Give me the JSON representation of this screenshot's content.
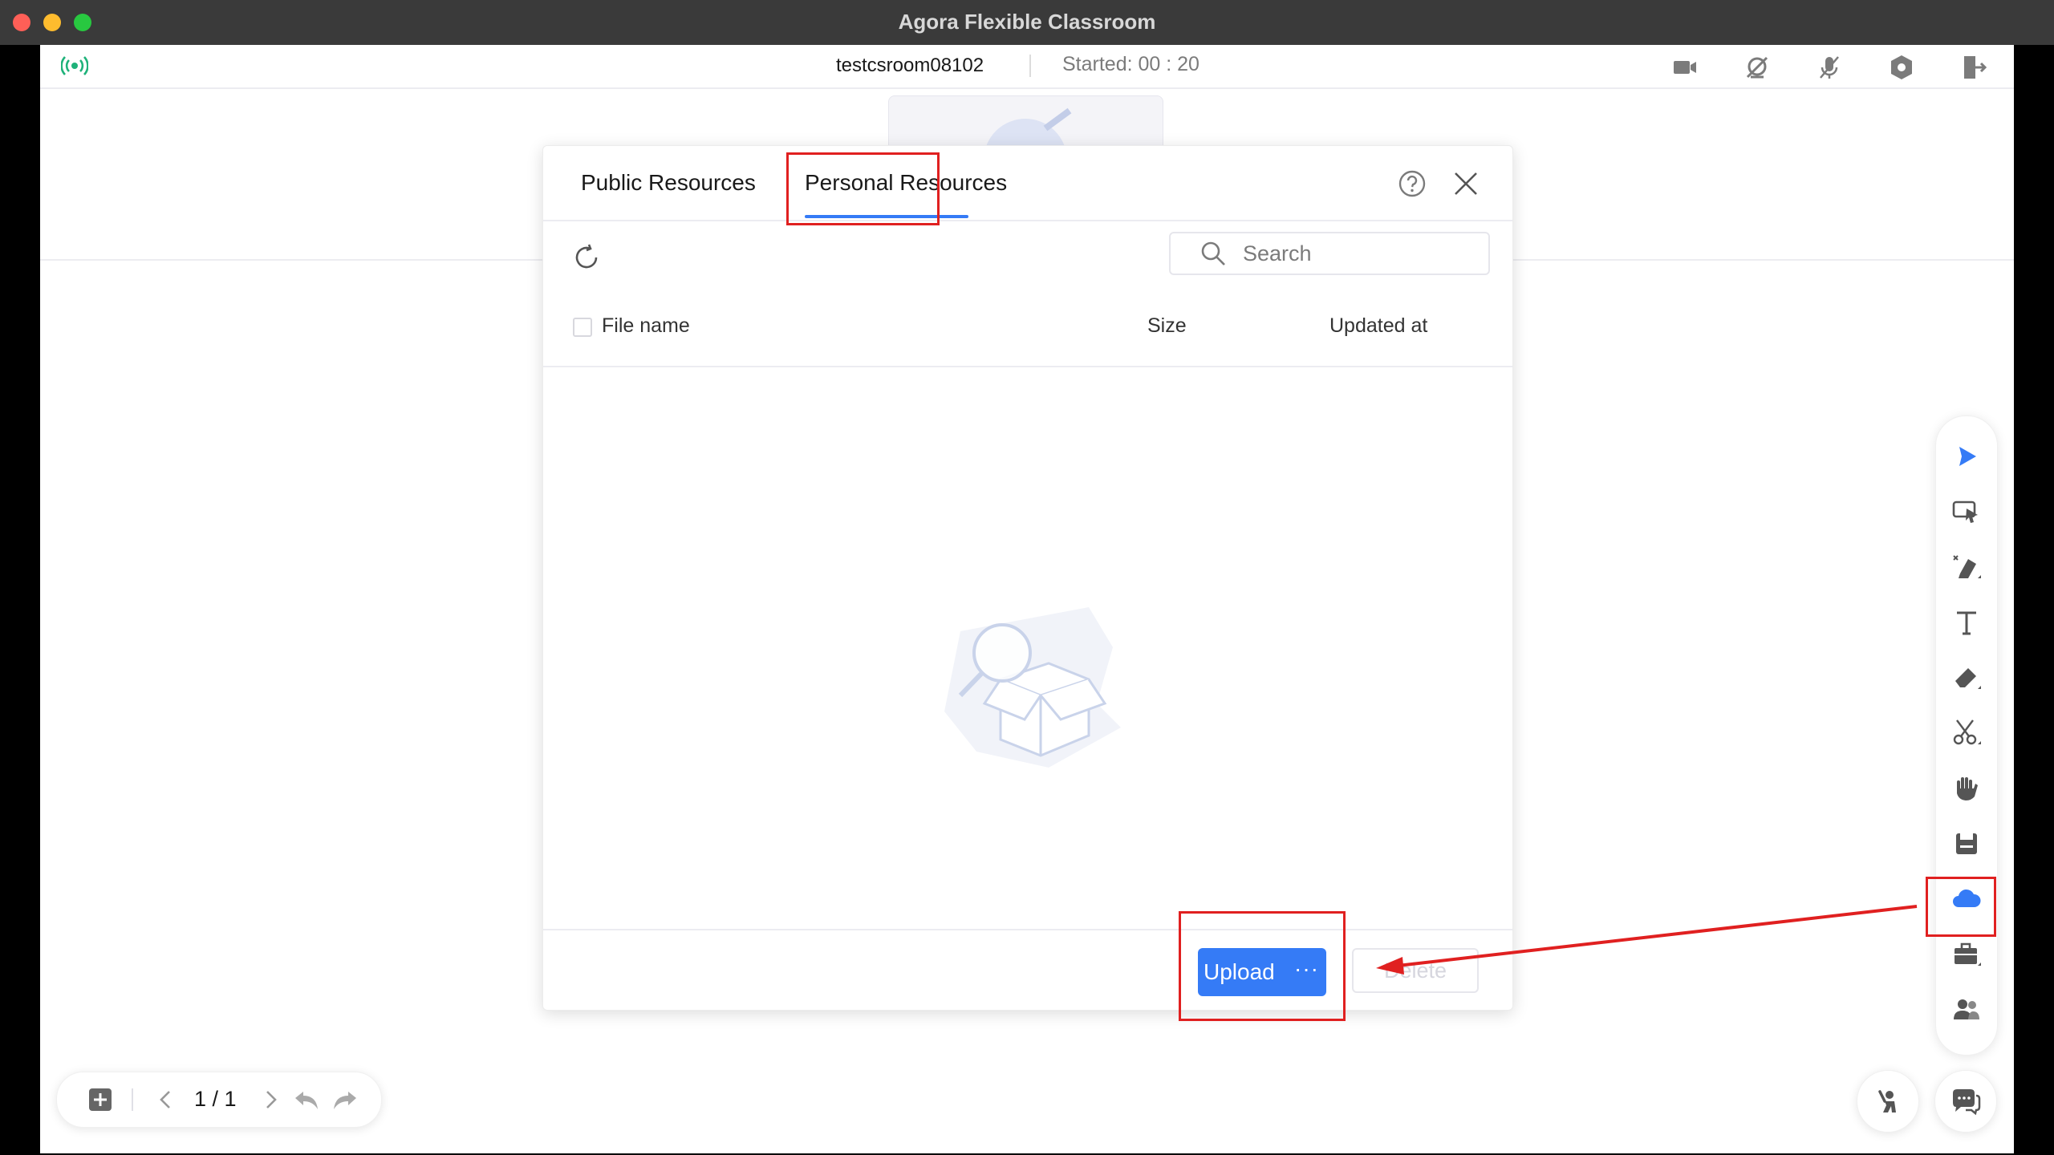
{
  "window": {
    "title": "Agora Flexible Classroom"
  },
  "header": {
    "room_name": "testcsroom08102",
    "started": "Started: 00 : 20",
    "icons": [
      "signal-icon",
      "camera-icon",
      "screen-share-icon",
      "mic-off-icon",
      "settings-icon",
      "exit-icon"
    ]
  },
  "dialog": {
    "tabs": [
      {
        "label": "Public Resources",
        "active": false
      },
      {
        "label": "Personal Resources",
        "active": true
      }
    ],
    "search": {
      "placeholder": "Search",
      "value": ""
    },
    "columns": {
      "name": "File name",
      "size": "Size",
      "updated": "Updated at"
    },
    "rows": [],
    "upload_label": "Upload",
    "upload_more": "···",
    "delete_label": "Delete"
  },
  "toolbar": {
    "tools": [
      "select-icon",
      "clicker-icon",
      "pen-icon",
      "text-icon",
      "eraser-icon",
      "scissors-icon",
      "hand-icon",
      "save-icon",
      "cloud-icon",
      "toolbox-icon",
      "students-icon"
    ]
  },
  "pager": {
    "page": "1 / 1"
  },
  "colors": {
    "accent": "#357bf6",
    "highlight": "#e02020",
    "titlebar": "#3a3a3a"
  }
}
